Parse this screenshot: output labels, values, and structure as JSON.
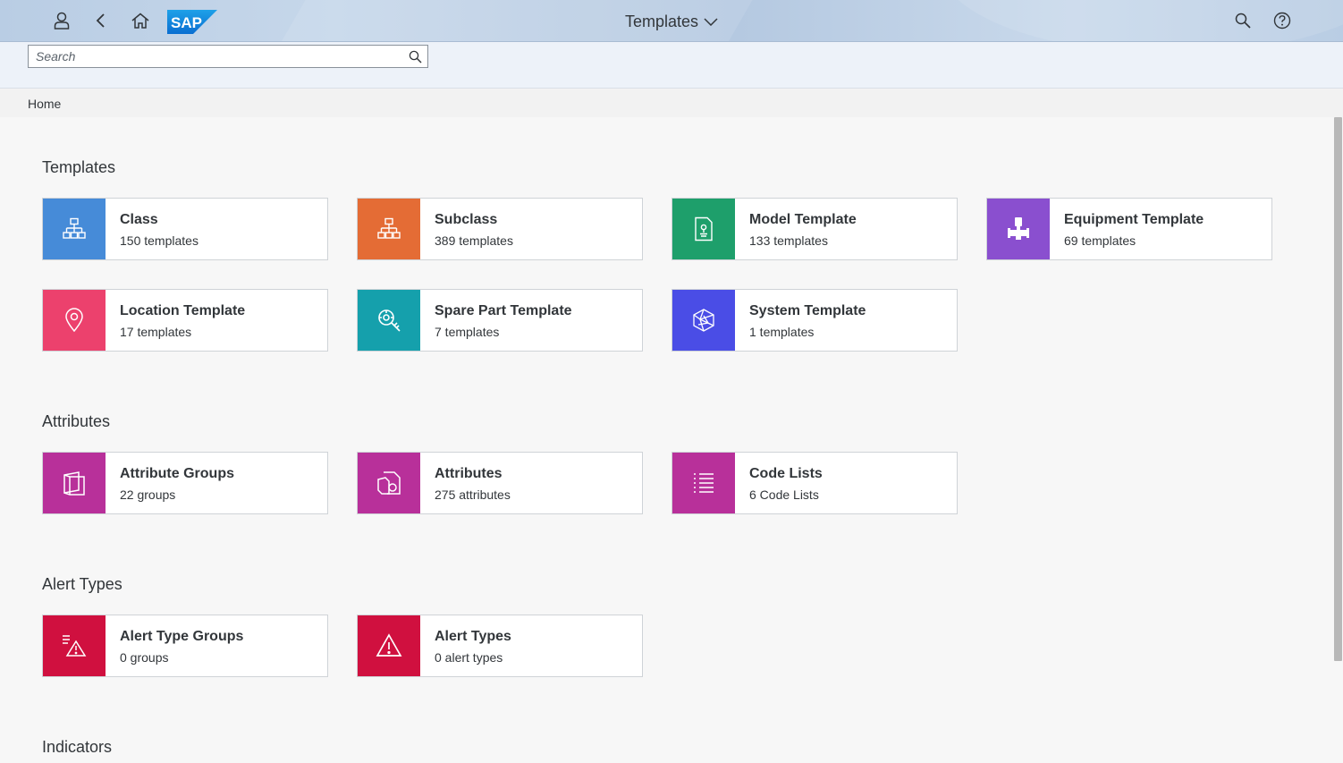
{
  "shell": {
    "title": "Templates",
    "logo_text": "SAP",
    "logo_color": "#0a6ed1"
  },
  "search": {
    "placeholder": "Search"
  },
  "breadcrumb": {
    "home": "Home"
  },
  "sections": {
    "templates": {
      "title": "Templates",
      "tiles": [
        {
          "name": "Class",
          "count": "150 templates",
          "color": "#468bd8",
          "icon": "hierarchy-icon"
        },
        {
          "name": "Subclass",
          "count": "389 templates",
          "color": "#e46c35",
          "icon": "hierarchy-icon"
        },
        {
          "name": "Model Template",
          "count": "133 templates",
          "color": "#1e9f6b",
          "icon": "model-document-icon"
        },
        {
          "name": "Equipment Template",
          "count": "69 templates",
          "color": "#8a4fcf",
          "icon": "equipment-icon"
        },
        {
          "name": "Location Template",
          "count": "17 templates",
          "color": "#ec416d",
          "icon": "location-pin-icon"
        },
        {
          "name": "Spare Part Template",
          "count": "7 templates",
          "color": "#15a0ac",
          "icon": "spare-part-icon"
        },
        {
          "name": "System Template",
          "count": "1 templates",
          "color": "#4a4de6",
          "icon": "system-network-icon"
        }
      ]
    },
    "attributes": {
      "title": "Attributes",
      "tiles": [
        {
          "name": "Attribute Groups",
          "count": "22 groups",
          "color": "#b8309a",
          "icon": "attribute-group-icon"
        },
        {
          "name": "Attributes",
          "count": "275 attributes",
          "color": "#b8309a",
          "icon": "attributes-icon"
        },
        {
          "name": "Code Lists",
          "count": "6 Code Lists",
          "color": "#b8309a",
          "icon": "list-icon"
        }
      ]
    },
    "alert_types": {
      "title": "Alert Types",
      "tiles": [
        {
          "name": "Alert Type Groups",
          "count": "0 groups",
          "color": "#d0103f",
          "icon": "alert-group-icon"
        },
        {
          "name": "Alert Types",
          "count": "0 alert types",
          "color": "#d0103f",
          "icon": "alert-icon"
        }
      ]
    },
    "indicators": {
      "title": "Indicators"
    }
  }
}
